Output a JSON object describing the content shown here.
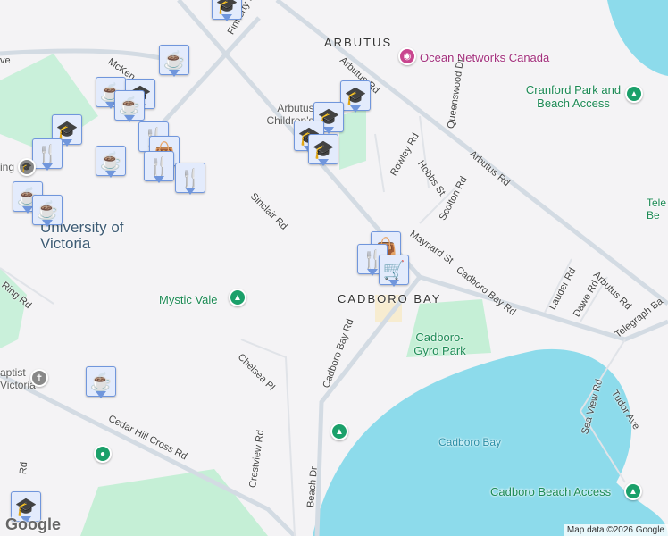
{
  "areas": {
    "arbutus": "ARBUTUS",
    "cadboro_bay": "CADBORO BAY",
    "university": "University of Victoria"
  },
  "places": {
    "ocean_networks": "Ocean Networks Canada",
    "arbutus_children": "Arbutus Children's C",
    "cranford": "Cranford Park and Beach Access",
    "mystic_vale": "Mystic Vale",
    "gyro_park": "Cadboro-Gyro Park",
    "cadboro_beach": "Cadboro Beach Access",
    "baptist": "aptist Victoria",
    "telegraph": "Tele Be",
    "ing": "ing"
  },
  "water": {
    "bay": "Cadboro Bay"
  },
  "roads": [
    "Finnerty Rd",
    "McKen",
    "Arbutus Rd",
    "Queenswood Dr",
    "Rowley Rd",
    "Hobbs St",
    "Scolton Rd",
    "Arbutus Rd",
    "Sinclair Rd",
    "Maynard St",
    "Cadboro Bay Rd",
    "Cadboro Bay Rd",
    "Lauder Rd",
    "Dawe Rd",
    "Arbutus Rd",
    "Telegraph Ba",
    "Ring Rd",
    "Chelsea Pl",
    "Cedar Hill Cross Rd",
    "Crestview Rd",
    "Beach Dr",
    "Sea View Rd",
    "Tudor Ave",
    "Rd",
    "ve"
  ],
  "attribution": "Map data ©2026 Google",
  "logo": "Google",
  "colors": {
    "water": "#8ddbeb",
    "park": "#c5efd6",
    "marker": "#0a4566"
  }
}
